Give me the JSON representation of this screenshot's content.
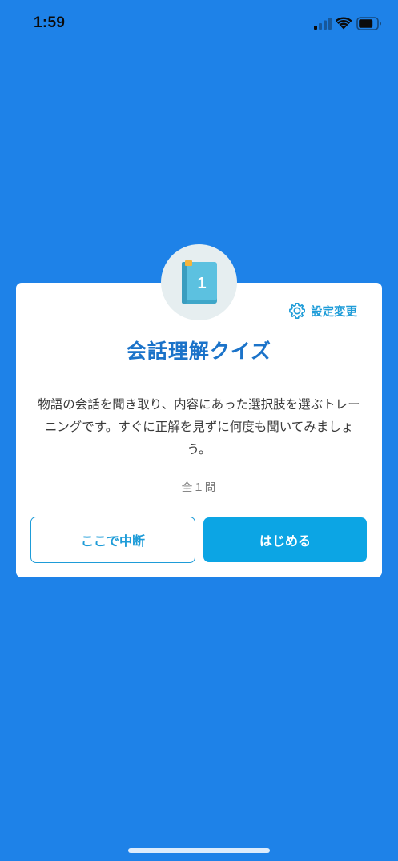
{
  "status_bar": {
    "time": "1:59"
  },
  "dialog": {
    "badge_number": "1",
    "settings_label": "設定変更",
    "title": "会話理解クイズ",
    "description": "物語の会話を聞き取り、内容にあった選択肢を選ぶトレーニングです。すぐに正解を見ずに何度も聞いてみましょう。",
    "question_count": "全１問",
    "pause_label": "ここで中断",
    "start_label": "はじめる"
  },
  "colors": {
    "background": "#1E82E8",
    "title": "#1B73C9",
    "accent": "#1E9CD8",
    "start_button": "#0CA5E4",
    "book": "#4FB8D8"
  },
  "icons": {
    "badge": "book-icon",
    "settings": "gear-icon",
    "status": [
      "signal-icon",
      "wifi-icon",
      "battery-icon"
    ]
  }
}
